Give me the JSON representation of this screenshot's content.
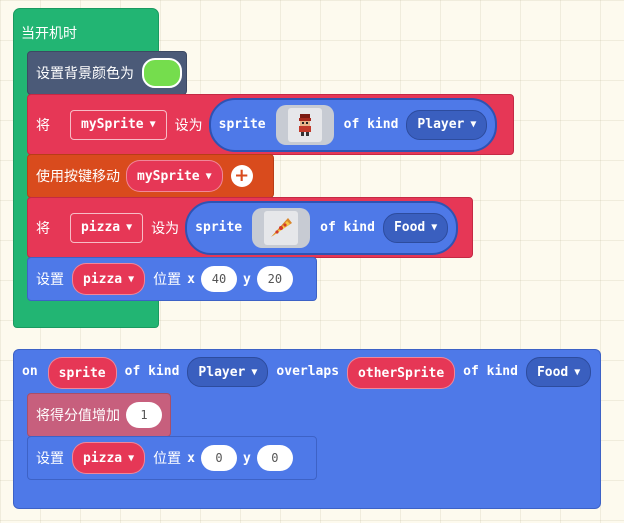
{
  "colors": {
    "event_green": "#22b573",
    "scene_slate": "#4b5a78",
    "sprites_red": "#e63756",
    "controller_orange": "#d94b1d",
    "sprite_blue": "#4e79e8",
    "info_pink": "#c75f7d",
    "bg_swatch": "#75dd4d"
  },
  "on_start": {
    "title": "当开机时",
    "set_bg": {
      "label": "设置背景颜色为",
      "color": "#75dd4d"
    },
    "set_player": {
      "prefix": "将",
      "var": "mySprite",
      "mid": "设为",
      "sprite_label": "sprite",
      "of_kind": "of kind",
      "kind": "Player",
      "image_icon": "player-sprite-icon"
    },
    "move": {
      "label": "使用按键移动",
      "var": "mySprite",
      "icon": "plus-icon"
    },
    "set_food": {
      "prefix": "将",
      "var": "pizza",
      "mid": "设为",
      "sprite_label": "sprite",
      "of_kind": "of kind",
      "kind": "Food",
      "image_icon": "pizza-sprite-icon"
    },
    "set_pos": {
      "label": "设置",
      "var": "pizza",
      "pos_label": "位置",
      "x_label": "x",
      "x": "40",
      "y_label": "y",
      "y": "20"
    }
  },
  "overlap": {
    "on": "on",
    "sprite_var": "sprite",
    "of_kind_1": "of kind",
    "kind_1": "Player",
    "overlaps": "overlaps",
    "other_var": "otherSprite",
    "of_kind_2": "of kind",
    "kind_2": "Food",
    "score": {
      "label": "将得分值增加",
      "value": "1"
    },
    "set_pos": {
      "label": "设置",
      "var": "pizza",
      "pos_label": "位置",
      "x_label": "x",
      "x": "0",
      "y_label": "y",
      "y": "0"
    }
  }
}
